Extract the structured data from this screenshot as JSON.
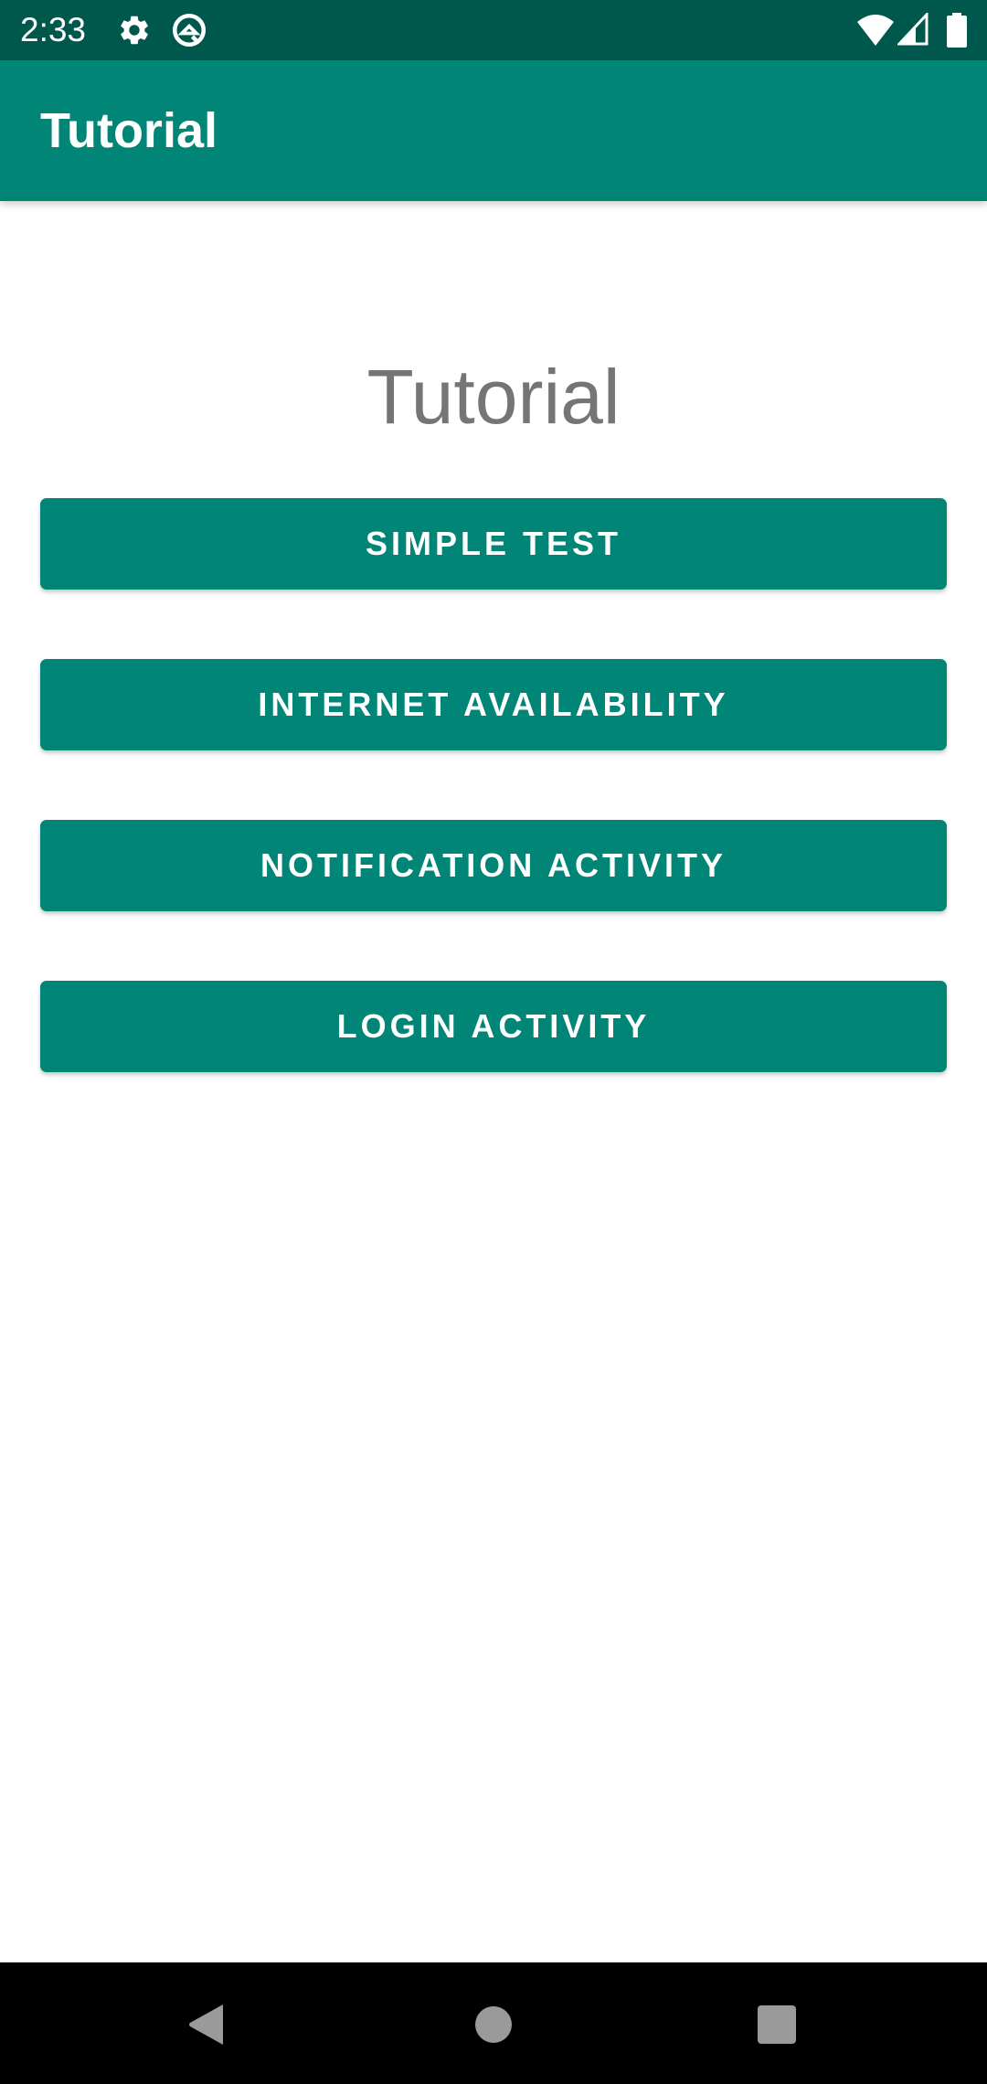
{
  "status_bar": {
    "time": "2:33",
    "left_icons": [
      "settings-gear-icon",
      "q-logo-icon"
    ],
    "right_icons": [
      "wifi-icon",
      "cell-signal-icon",
      "battery-icon"
    ]
  },
  "app_bar": {
    "title": "Tutorial"
  },
  "main": {
    "heading": "Tutorial",
    "buttons": [
      {
        "label": "SIMPLE TEST"
      },
      {
        "label": "INTERNET AVAILABILITY"
      },
      {
        "label": "NOTIFICATION ACTIVITY"
      },
      {
        "label": "LOGIN ACTIVITY"
      }
    ]
  },
  "nav_bar": {
    "icons": [
      "back-icon",
      "home-icon",
      "recents-icon"
    ]
  },
  "colors": {
    "primary": "#008577",
    "primary_dark": "#00574b",
    "heading_text": "#757575",
    "button_text": "#ffffff"
  }
}
